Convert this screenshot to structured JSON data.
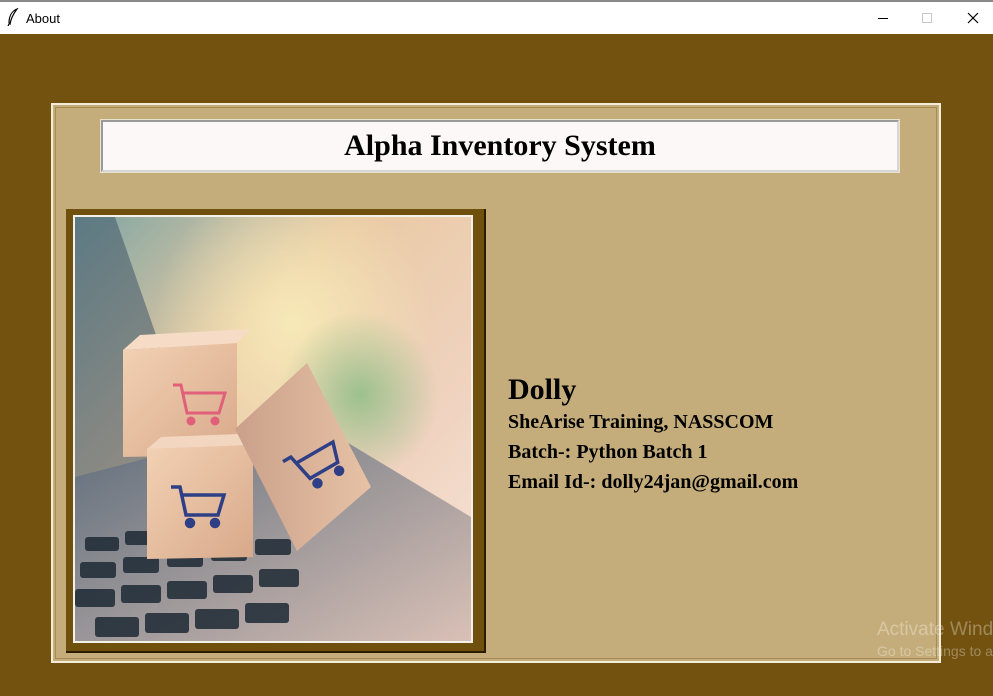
{
  "window": {
    "title": "About",
    "controls": {
      "minimize_icon": "minimize-icon",
      "maximize_icon": "maximize-icon",
      "close_icon": "close-icon"
    }
  },
  "colors": {
    "background": "#72520e",
    "panel": "#c4ad7a",
    "header_box": "#fcf8f7",
    "image_frame": "#6f500c"
  },
  "header": {
    "title": "Alpha Inventory System"
  },
  "image": {
    "description_icon": "shopping-cart-boxes-laptop-image"
  },
  "info": {
    "name": "Dolly",
    "line1": "SheArise Training, NASSCOM",
    "line2": "Batch-: Python Batch 1",
    "line3": "Email Id-: dolly24jan@gmail.com"
  },
  "watermark": {
    "title": "Activate Windows",
    "subtitle": "Go to Settings to activate Windows."
  }
}
